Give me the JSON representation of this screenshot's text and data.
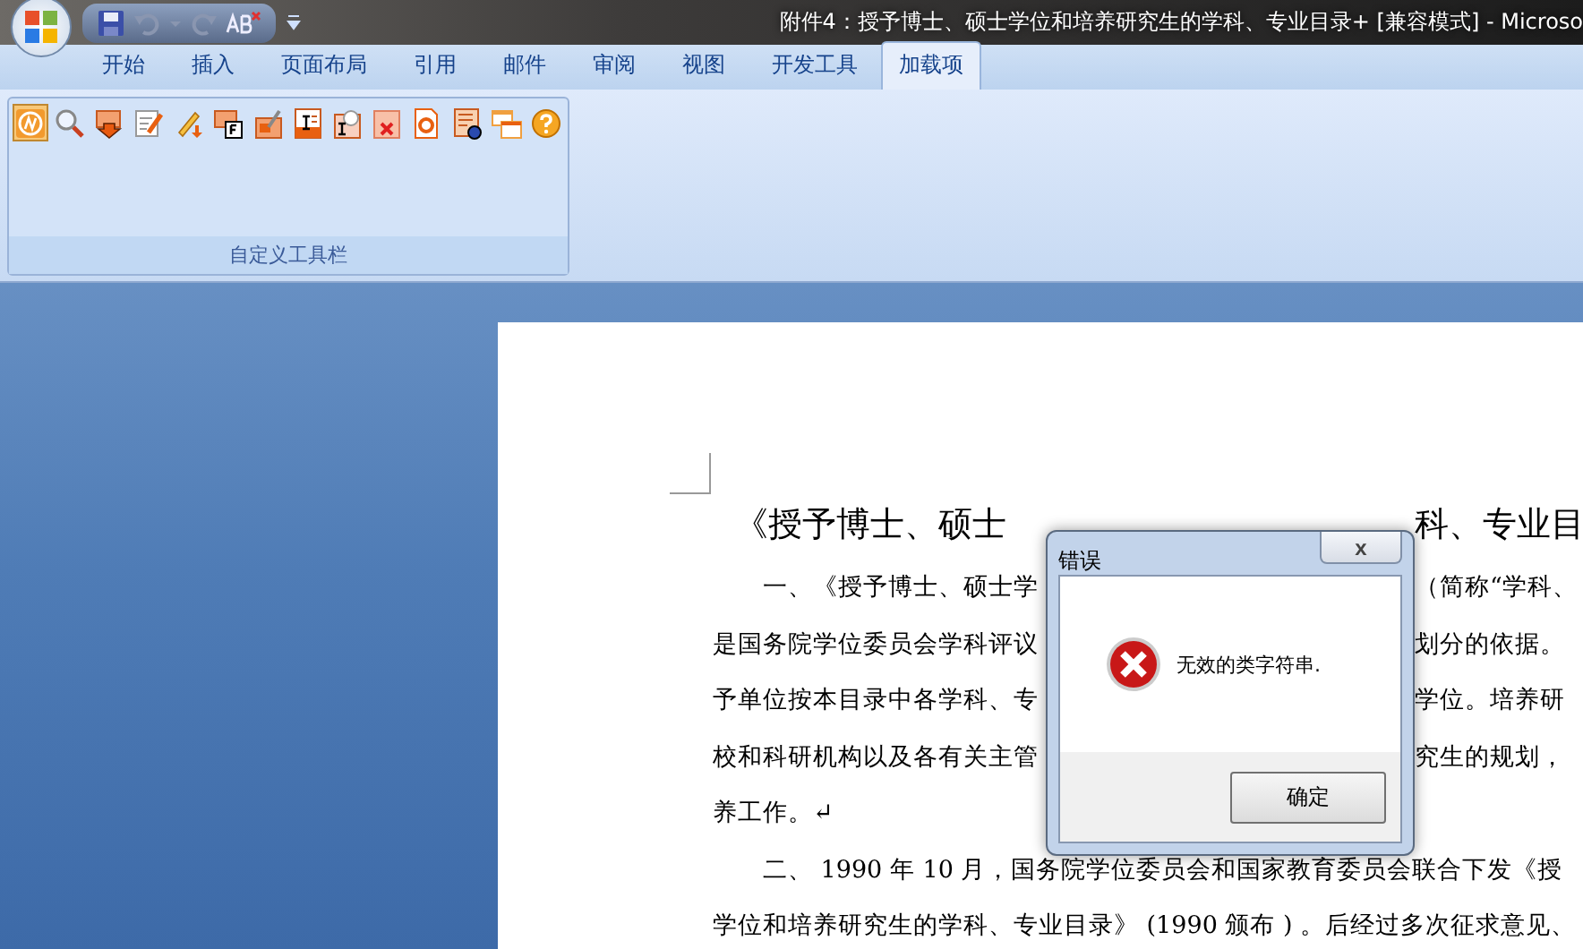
{
  "window": {
    "title": "附件4：授予博士、硕士学位和培养研究生的学科、专业目录+ [兼容模式] - Microso"
  },
  "tabs": [
    {
      "label": "开始",
      "selected": false
    },
    {
      "label": "插入",
      "selected": false
    },
    {
      "label": "页面布局",
      "selected": false
    },
    {
      "label": "引用",
      "selected": false
    },
    {
      "label": "邮件",
      "selected": false
    },
    {
      "label": "审阅",
      "selected": false
    },
    {
      "label": "视图",
      "selected": false
    },
    {
      "label": "开发工具",
      "selected": false
    },
    {
      "label": "加载项",
      "selected": true
    }
  ],
  "toolbar": {
    "label": "自定义工具栏",
    "buttons": [
      {
        "selected": true
      },
      {
        "selected": false
      },
      {
        "selected": false
      },
      {
        "selected": false
      },
      {
        "selected": false
      },
      {
        "selected": false
      },
      {
        "selected": false
      },
      {
        "selected": false
      },
      {
        "selected": false
      },
      {
        "selected": false
      },
      {
        "selected": false
      },
      {
        "selected": false
      },
      {
        "selected": false
      },
      {
        "selected": false
      }
    ]
  },
  "document": {
    "lines": [
      {
        "kind": "title",
        "left": "《授予博士、硕士",
        "right": "科、专业目"
      },
      {
        "kind": "indent",
        "left": "一、《授予博士、硕士学",
        "right": "（简称“学科、"
      },
      {
        "kind": "plain",
        "left": "是国务院学位委员会学科评议",
        "right": "划分的依据。"
      },
      {
        "kind": "plain",
        "left": "予单位按本目录中各学科、专",
        "right": "学位。培养研"
      },
      {
        "kind": "plain",
        "left": "校和科研机构以及各有关主管",
        "right": "究生的规划，"
      },
      {
        "kind": "plain",
        "left": "养工作。↵"
      },
      {
        "kind": "indent",
        "left": "二、 1990 年 10 月，国务院学位委员会和国家教育委员会联合下发《授"
      },
      {
        "kind": "plain",
        "left": "学位和培养研究生的学科、专业目录》 (1990 颁布 ) 。后经过多次征求意见、"
      }
    ]
  },
  "dialog": {
    "title": "错误",
    "close": "x",
    "message": "无效的类字符串.",
    "button": "确定"
  }
}
